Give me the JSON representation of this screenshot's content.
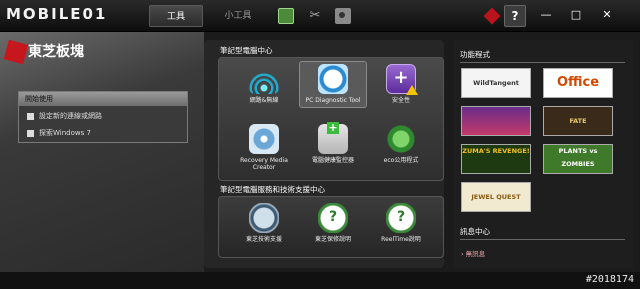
{
  "topbar": {
    "logo": "MOBILE01",
    "tab_tools": "工具",
    "tab_gadgets": "小工具",
    "help": "?",
    "minimize": "—",
    "maximize": "□",
    "close": "✕"
  },
  "left": {
    "brand": "東芝板塊",
    "start_box": {
      "title": "開始使用",
      "items": [
        "設定新的連線或網路",
        "探索Windows 7"
      ]
    }
  },
  "center": {
    "section1_title": "筆記型電腦中心",
    "tiles1": [
      {
        "label": "網路&無線",
        "icon": "wifi-icon"
      },
      {
        "label": "PC Diagnostic Tool",
        "icon": "diagnostic-icon"
      },
      {
        "label": "安全性",
        "icon": "security-icon"
      },
      {
        "label": "Recovery Media Creator",
        "icon": "disc-icon"
      },
      {
        "label": "電腦健康監控器",
        "icon": "health-monitor-icon"
      },
      {
        "label": "eco公用程式",
        "icon": "eco-icon"
      }
    ],
    "section2_title": "筆記型電腦服務和技術支援中心",
    "tiles2": [
      {
        "label": "東芝技術支援",
        "icon": "globe-icon"
      },
      {
        "label": "東芝保修說明",
        "icon": "help-icon"
      },
      {
        "label": "ReelTime說明",
        "icon": "help-icon"
      }
    ]
  },
  "right": {
    "apps_title": "功能程式",
    "games": [
      "WildTangent Games",
      "Office",
      "",
      "FATE",
      "ZUMA'S REVENGE!",
      "PLANTS vs ZOMBIES",
      "JEWEL QUEST"
    ],
    "news_title": "訊息中心",
    "news_link": "無訊息"
  },
  "watermark": "#2018174"
}
